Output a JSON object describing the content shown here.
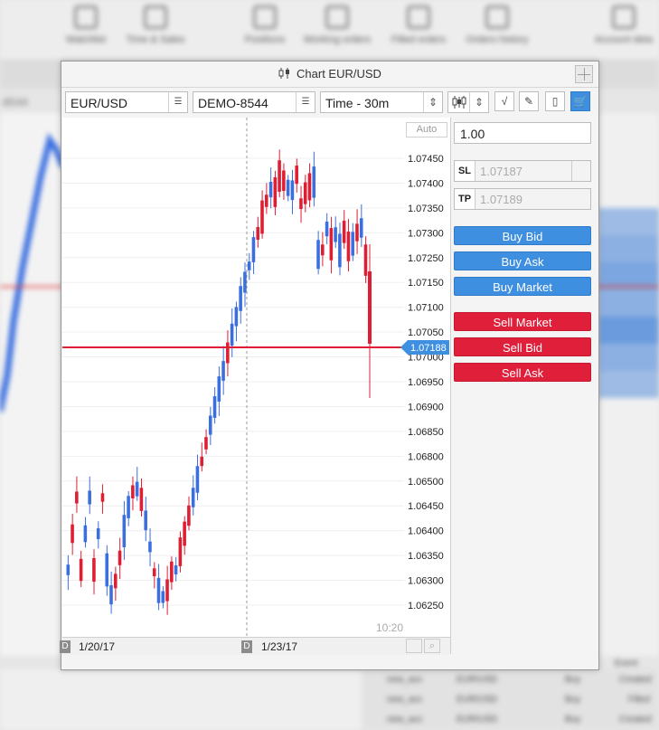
{
  "background": {
    "toolbar_items": [
      "Watchlist",
      "Time & Sales",
      "Positions",
      "Working orders",
      "Filled orders",
      "Orders history",
      "Account deta"
    ],
    "left_label": "-8544",
    "bottom_rows": [
      {
        "account": "new_acc",
        "symbol": "EUR/USD",
        "side": "Buy",
        "status": "Created"
      },
      {
        "account": "new_acc",
        "symbol": "EUR/USD",
        "side": "Buy",
        "status": "Filled"
      },
      {
        "account": "new_acc",
        "symbol": "EUR/USD",
        "side": "Buy",
        "status": "Created"
      }
    ],
    "right_header": "Event"
  },
  "window": {
    "title": "Chart EUR/USD",
    "symbol": "EUR/USD",
    "account": "DEMO-8544",
    "timeframe": "Time - 30m"
  },
  "chart_data": {
    "type": "candlestick",
    "auto_label": "Auto",
    "current_price": "1.07188",
    "time_label": "10:20",
    "y_ticks": [
      "1.07450",
      "1.07400",
      "1.07350",
      "1.07300",
      "1.07250",
      "1.07150",
      "1.07100",
      "1.07050",
      "1.07000",
      "1.06950",
      "1.06900",
      "1.06850",
      "1.06800",
      "1.06500",
      "1.06450",
      "1.06400",
      "1.06350",
      "1.06300",
      "1.06250"
    ],
    "x_labels": [
      {
        "marker": "D",
        "date": "1/20/17"
      },
      {
        "marker": "D",
        "date": "1/23/17"
      }
    ],
    "colors": {
      "up": "#3b6fe0",
      "down": "#e01e33",
      "price_line": "#e01e33",
      "label_bg": "#3e8fe0"
    }
  },
  "trade": {
    "quantity": "1.00",
    "sl_tag": "SL",
    "sl_value": "1.07187",
    "tp_tag": "TP",
    "tp_value": "1.07189",
    "buy_bid": "Buy Bid",
    "buy_ask": "Buy Ask",
    "buy_market": "Buy Market",
    "sell_market": "Sell Market",
    "sell_bid": "Sell Bid",
    "sell_ask": "Sell Ask"
  }
}
